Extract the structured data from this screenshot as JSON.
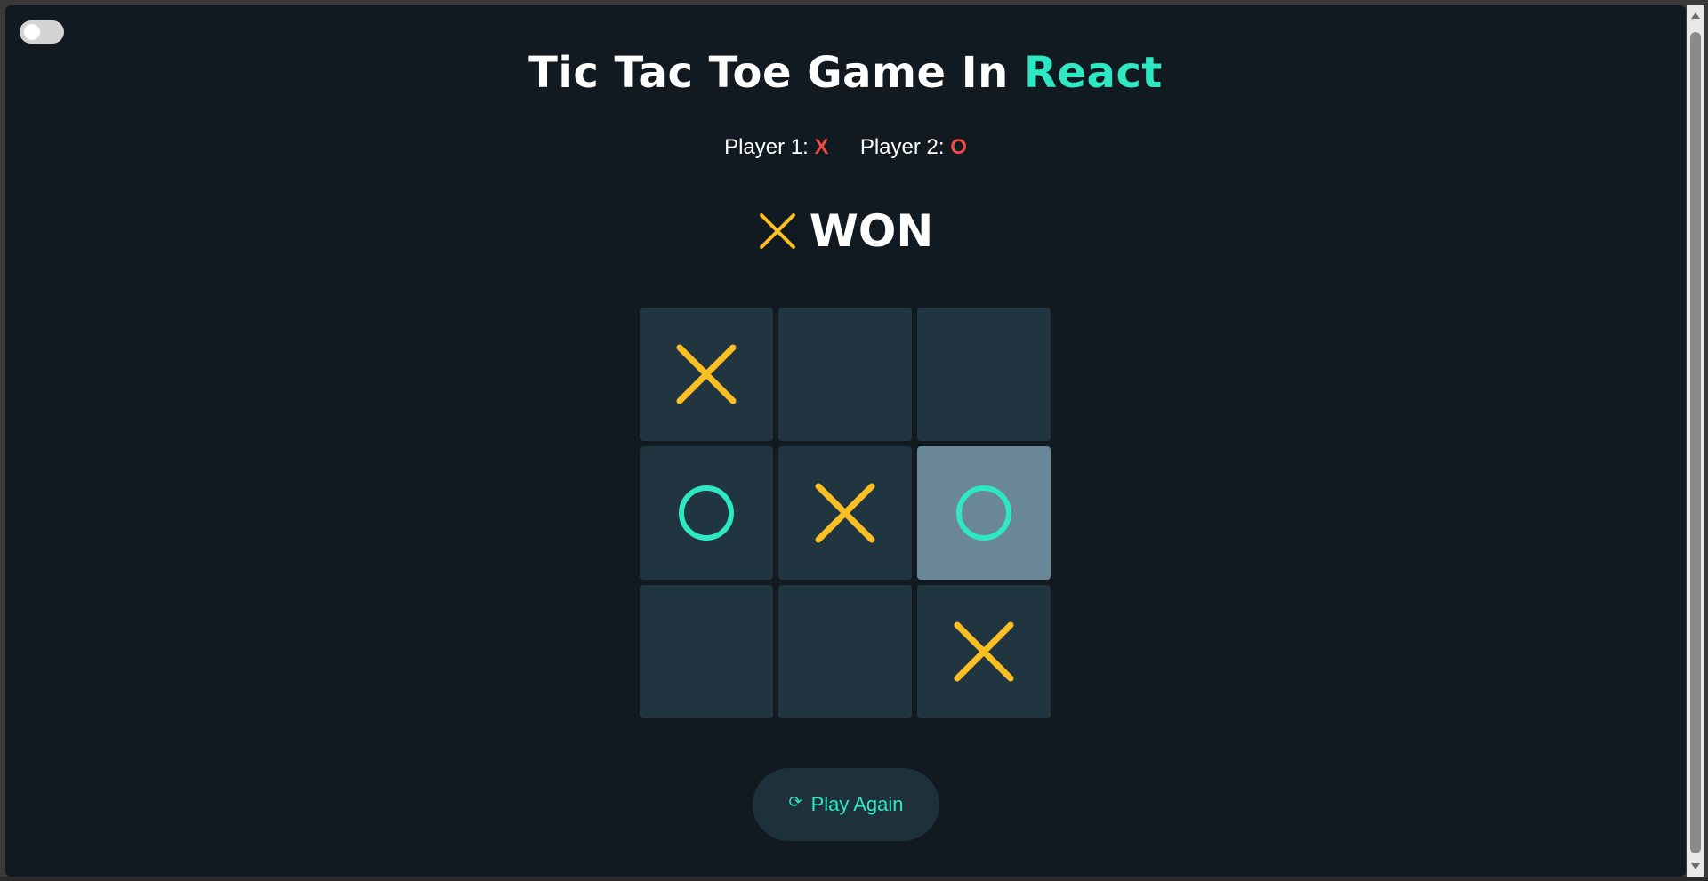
{
  "header": {
    "title_main": "Tic Tac Toe Game In ",
    "title_accent": "React"
  },
  "players": {
    "player1_label": "Player 1:",
    "player1_symbol": "X",
    "player2_label": "Player 2:",
    "player2_symbol": "O"
  },
  "result": {
    "winner_symbol": "X",
    "text": "WON"
  },
  "board": {
    "cells": [
      "X",
      "",
      "",
      "O",
      "X",
      "O",
      "",
      "",
      "X"
    ],
    "highlighted_cell_index": 5
  },
  "actions": {
    "play_again_icon": "⟳",
    "play_again_label": "Play Again"
  },
  "theme": {
    "background": "#101a20",
    "cell": "#213540",
    "cell_highlight": "#6a8798",
    "x_color": "#fbbf24",
    "o_color": "#2ee8c3",
    "accent": "#2ee8c3",
    "symbol_label_color": "#ef4a43"
  },
  "theme_toggle": {
    "state": "off"
  }
}
